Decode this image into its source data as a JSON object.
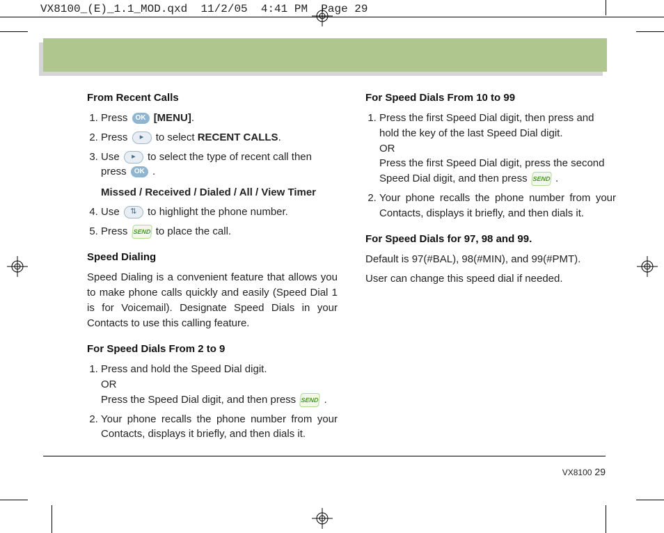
{
  "header": "VX8100_(E)_1.1_MOD.qxd  11/2/05  4:41 PM  Page 29",
  "left": {
    "h1": "From  Recent Calls",
    "li1a": "Press ",
    "li1b": " [MENU]",
    "li1c": ".",
    "li2a": "Press ",
    "li2b": " to select ",
    "li2c": "RECENT CALLS",
    "li2d": ".",
    "li3a": "Use ",
    "li3b": " to select the type of recent call then press ",
    "li3c": " .",
    "boldline": "Missed / Received / Dialed / All / View Timer",
    "li4a": "Use ",
    "li4b": " to highlight the phone number.",
    "li5a": "Press ",
    "li5b": " to place the call.",
    "h2": "Speed Dialing",
    "p2": "Speed Dialing is a convenient feature that allows you to make phone calls quickly and easily (Speed Dial 1 is for Voicemail). Designate Speed Dials in your Contacts to use this calling feature.",
    "h3": "For Speed Dials From 2 to 9",
    "sd1a": "Press and hold the Speed Dial digit.",
    "sd1b": "OR",
    "sd1c": "Press the Speed Dial digit, and then press ",
    "sd1d": " .",
    "sd2": "Your phone recalls the phone number from your Contacts, displays it briefly, and then dials it."
  },
  "right": {
    "h1": "For Speed Dials From 10 to 99",
    "r1a": "Press the first Speed Dial digit, then press and hold the key of the last Speed Dial digit.",
    "r1b": "OR",
    "r1c": "Press the first Speed Dial digit, press the second Speed Dial digit, and then press ",
    "r1d": " .",
    "r2": "Your phone recalls the phone number from your Contacts, displays it briefly, and then dials it.",
    "h2": "For Speed Dials for 97, 98 and 99.",
    "p1": "Default is 97(#BAL), 98(#MIN), and 99(#PMT).",
    "p2": "User can change this speed dial if needed."
  },
  "footer": {
    "model": "VX8100",
    "page": "29"
  },
  "icons": {
    "ok": "OK",
    "right": "▸",
    "updown": "⇅",
    "send": "SEND"
  }
}
